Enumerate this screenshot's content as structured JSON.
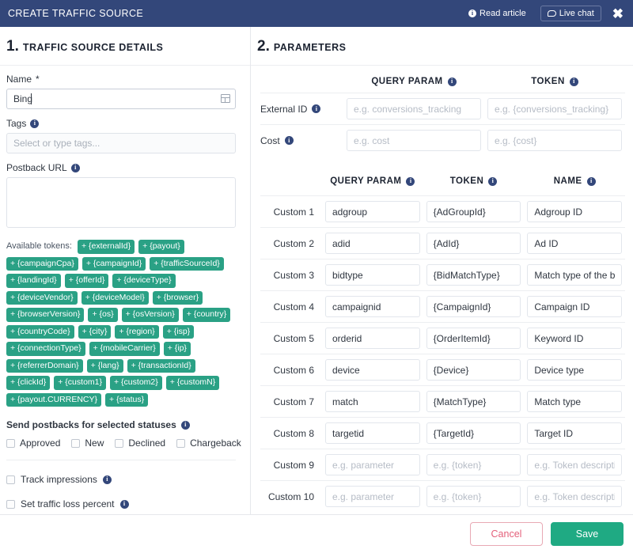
{
  "header": {
    "title": "CREATE TRAFFIC SOURCE",
    "read_article": "Read article",
    "live_chat": "Live chat",
    "close": "✖",
    "info_glyph": "i",
    "bg_color": "#33477a"
  },
  "left": {
    "section_number": "1.",
    "section_title": "TRAFFIC SOURCE DETAILS",
    "name_label": "Name",
    "name_required": "*",
    "name_value": "Bing",
    "tags_label": "Tags",
    "tags_placeholder": "Select or type tags...",
    "postback_label": "Postback URL",
    "postback_value": "",
    "tokens_label": "Available tokens:",
    "tokens": [
      "+ {externalId}",
      "+ {payout}",
      "+ {campaignCpa}",
      "+ {campaignId}",
      "+ {trafficSourceId}",
      "+ {landingId}",
      "+ {offerId}",
      "+ {deviceType}",
      "+ {deviceVendor}",
      "+ {deviceModel}",
      "+ {browser}",
      "+ {browserVersion}",
      "+ {os}",
      "+ {osVersion}",
      "+ {country}",
      "+ {countryCode}",
      "+ {city}",
      "+ {region}",
      "+ {isp}",
      "+ {connectionType}",
      "+ {mobileCarrier}",
      "+ {ip}",
      "+ {referrerDomain}",
      "+ {lang}",
      "+ {transactionId}",
      "+ {clickId}",
      "+ {custom1}",
      "+ {custom2}",
      "+ {customN}",
      "+ {payout.CURRENCY}",
      "+ {status}"
    ],
    "token_color": "#2aa185",
    "statuses_title": "Send postbacks for selected statuses",
    "statuses": [
      "Approved",
      "New",
      "Declined",
      "Chargeback"
    ],
    "track_impressions": "Track impressions",
    "set_traffic_loss": "Set traffic loss percent"
  },
  "right": {
    "section_number": "2.",
    "section_title": "PARAMETERS",
    "top_headers": [
      "QUERY PARAM",
      "TOKEN"
    ],
    "top_rows": [
      {
        "label": "External ID",
        "query_placeholder": "e.g. conversions_tracking",
        "query_value": "",
        "token_placeholder": "e.g. {conversions_tracking}",
        "token_value": ""
      },
      {
        "label": "Cost",
        "query_placeholder": "e.g. cost",
        "query_value": "",
        "token_placeholder": "e.g. {cost}",
        "token_value": ""
      }
    ],
    "custom_headers": [
      "QUERY PARAM",
      "TOKEN",
      "NAME"
    ],
    "custom_rows": [
      {
        "label": "Custom 1",
        "query": "adgroup",
        "token": "{AdGroupId}",
        "name": "Adgroup ID"
      },
      {
        "label": "Custom 2",
        "query": "adid",
        "token": "{AdId}",
        "name": "Ad ID"
      },
      {
        "label": "Custom 3",
        "query": "bidtype",
        "token": "{BidMatchType}",
        "name": "Match type of the bid"
      },
      {
        "label": "Custom 4",
        "query": "campaignid",
        "token": "{CampaignId}",
        "name": "Campaign ID"
      },
      {
        "label": "Custom 5",
        "query": "orderid",
        "token": "{OrderItemId}",
        "name": "Keyword ID"
      },
      {
        "label": "Custom 6",
        "query": "device",
        "token": "{Device}",
        "name": "Device type"
      },
      {
        "label": "Custom 7",
        "query": "match",
        "token": "{MatchType}",
        "name": "Match type"
      },
      {
        "label": "Custom 8",
        "query": "targetid",
        "token": "{TargetId}",
        "name": "Target ID"
      },
      {
        "label": "Custom 9",
        "query": "",
        "token": "",
        "name": ""
      },
      {
        "label": "Custom 10",
        "query": "",
        "token": "",
        "name": ""
      }
    ],
    "custom_placeholders": {
      "query": "e.g. parameter",
      "token": "e.g. {token}",
      "name": "e.g. Token description"
    }
  },
  "footer": {
    "cancel": "Cancel",
    "save": "Save",
    "cancel_color": "#e4607a",
    "save_color": "#1faa83"
  }
}
